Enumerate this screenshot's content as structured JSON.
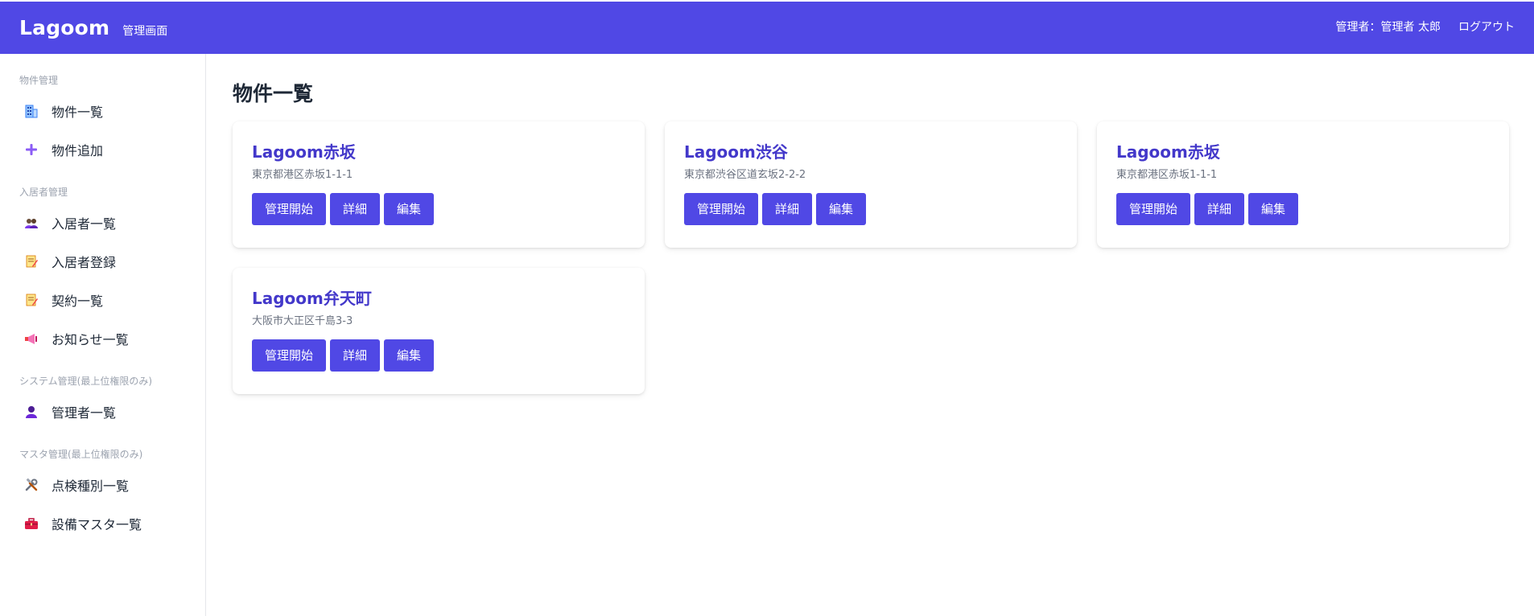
{
  "header": {
    "brand": "Lagoom",
    "subtitle": "管理画面",
    "user": "管理者：管理者 太郎",
    "logout": "ログアウト"
  },
  "sidebar": {
    "sections": [
      {
        "title": "物件管理",
        "items": [
          {
            "label": "物件一覧",
            "icon": "building-icon"
          },
          {
            "label": "物件追加",
            "icon": "plus-icon"
          }
        ]
      },
      {
        "title": "入居者管理",
        "items": [
          {
            "label": "入居者一覧",
            "icon": "users-icon"
          },
          {
            "label": "入居者登録",
            "icon": "memo-icon"
          },
          {
            "label": "契約一覧",
            "icon": "memo-icon"
          },
          {
            "label": "お知らせ一覧",
            "icon": "megaphone-icon"
          }
        ]
      },
      {
        "title": "システム管理(最上位権限のみ)",
        "items": [
          {
            "label": "管理者一覧",
            "icon": "user-icon"
          }
        ]
      },
      {
        "title": "マスタ管理(最上位権限のみ)",
        "items": [
          {
            "label": "点検種別一覧",
            "icon": "tools-icon"
          },
          {
            "label": "設備マスタ一覧",
            "icon": "toolbox-icon"
          }
        ]
      }
    ]
  },
  "main": {
    "title": "物件一覧",
    "buttons": {
      "start": "管理開始",
      "detail": "詳細",
      "edit": "編集"
    },
    "properties": [
      {
        "name": "Lagoom赤坂",
        "address": "東京都港区赤坂1-1-1"
      },
      {
        "name": "Lagoom渋谷",
        "address": "東京都渋谷区道玄坂2-2-2"
      },
      {
        "name": "Lagoom赤坂",
        "address": "東京都港区赤坂1-1-1"
      },
      {
        "name": "Lagoom弁天町",
        "address": "大阪市大正区千島3-3"
      }
    ]
  },
  "colors": {
    "primary": "#5048e5",
    "card_title": "#4338ca"
  }
}
